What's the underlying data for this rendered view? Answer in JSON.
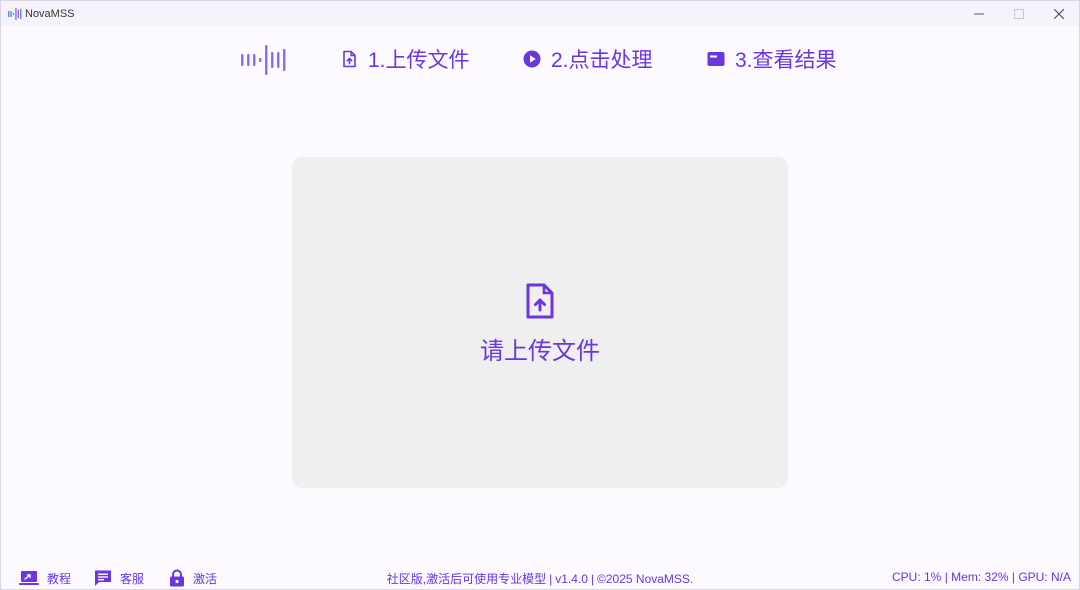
{
  "window": {
    "title": "NovaMSS"
  },
  "steps": [
    {
      "label": "1.上传文件",
      "icon": "file-upload-icon"
    },
    {
      "label": "2.点击处理",
      "icon": "play-circle-icon"
    },
    {
      "label": "3.查看结果",
      "icon": "result-card-icon"
    }
  ],
  "upload": {
    "prompt": "请上传文件",
    "icon": "file-upload-icon"
  },
  "footer": {
    "tutorial": "教程",
    "service": "客服",
    "activate": "激活",
    "edition_note": "社区版,激活后可使用专业模型",
    "version": "v1.4.0",
    "copyright": "©2025 NovaMSS.",
    "cpu": "CPU: 1%",
    "mem": "Mem: 32%",
    "gpu": "GPU: N/A"
  },
  "colors": {
    "accent": "#6b35e0",
    "panel": "#efeff0",
    "background": "#fcfaff"
  }
}
